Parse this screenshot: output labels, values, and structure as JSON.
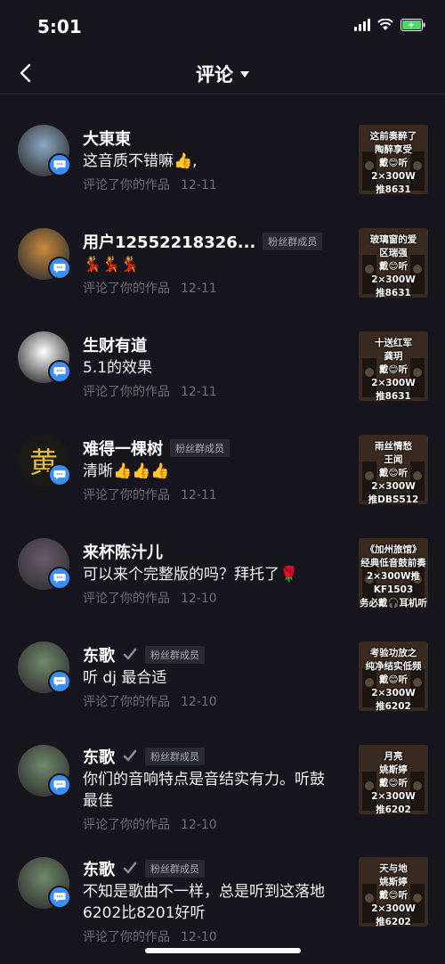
{
  "status": {
    "time": "5:01"
  },
  "nav": {
    "title": "评论"
  },
  "comments": [
    {
      "user": "大東東",
      "text": "这音质不错嘛👍,",
      "action": "评论了你的作品",
      "date": "12-11",
      "fan": "",
      "thumb": "这前奏醉了\n陶醉享受\n戴😊听\n2×300W\n推8631",
      "avatar_color": "#8aa7c4"
    },
    {
      "user": "用户12552218326...",
      "text": "💃💃💃",
      "action": "评论了你的作品",
      "date": "12-11",
      "fan": "粉丝群成员",
      "thumb": "玻璃窗的爱\n区瑞强\n戴😊听\n2×300W\n推8631",
      "avatar_color": "#c98a3a"
    },
    {
      "user": "生财有道",
      "text": "5.1的效果",
      "action": "评论了你的作品",
      "date": "12-11",
      "fan": "",
      "thumb": "十送红军\n龚玥\n戴😊听\n2×300W\n推8631",
      "avatar_color": "#ffffff"
    },
    {
      "user": "难得一棵树",
      "text": "清晰👍👍👍",
      "action": "评论了你的作品",
      "date": "12-11",
      "fan": "粉丝群成员",
      "thumb": "雨丝情愁\n王闻\n戴😊听\n2×300W\n推DBS512",
      "avatar_color": "#222222",
      "avatar_char": "黄"
    },
    {
      "user": "来杯陈汁儿",
      "text": "可以来个完整版的吗？拜托了🌹",
      "action": "评论了你的作品",
      "date": "12-10",
      "fan": "",
      "thumb": "《加州旅馆》\n经典低音鼓前奏\n2×300W推KF1503\n务必戴🎧耳机听",
      "avatar_color": "#6b5a6e"
    },
    {
      "user": "东歌",
      "text": "听 dj 最合适",
      "action": "评论了你的作品",
      "date": "12-10",
      "fan": "粉丝群成员",
      "thumb": "考验功放之\n纯净结实低频\n戴😊听\n2×300W\n推6202",
      "avatar_color": "#6f8a6a"
    },
    {
      "user": "东歌",
      "text": "你们的音响特点是音结实有力。听鼓最佳",
      "action": "评论了你的作品",
      "date": "12-10",
      "fan": "粉丝群成员",
      "thumb": "月亮\n姚斯婷\n戴😊听\n2×300W\n推6202",
      "avatar_color": "#6f8a6a"
    },
    {
      "user": "东歌",
      "text": "不知是歌曲不一样，总是听到这落地6202比8201好听",
      "action": "评论了你的作品",
      "date": "12-10",
      "fan": "粉丝群成员",
      "thumb": "天与地\n姚斯婷\n戴😊听\n2×300W\n推6202",
      "avatar_color": "#6f8a6a"
    }
  ]
}
